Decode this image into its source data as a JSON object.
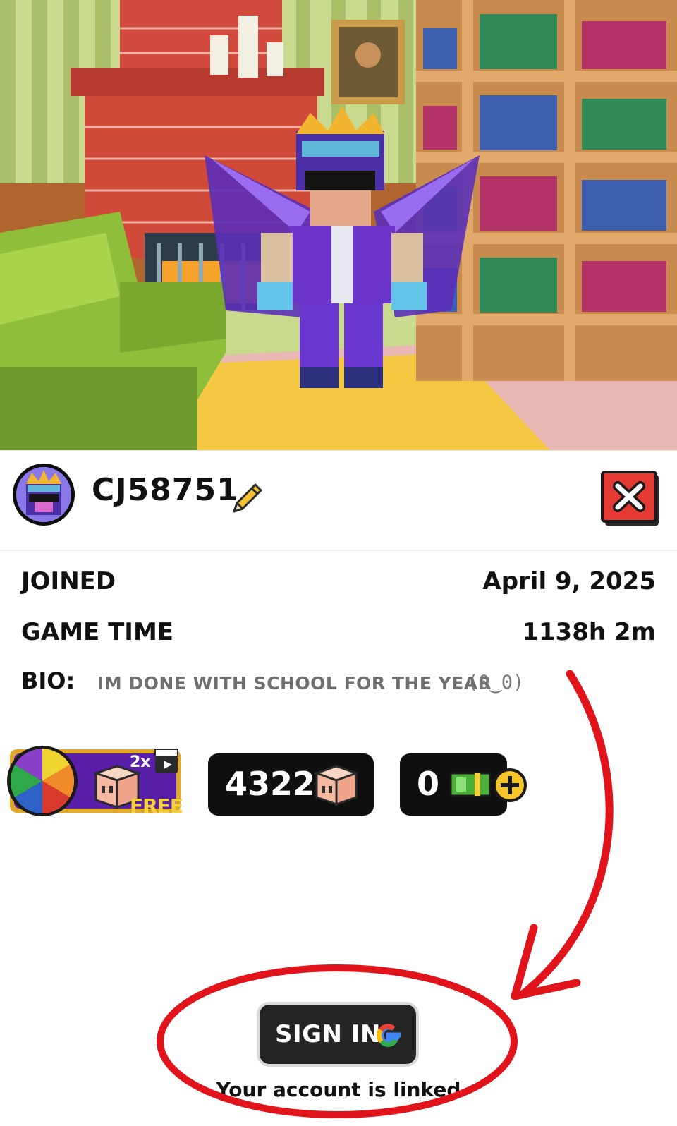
{
  "profile": {
    "username": "CJ58751",
    "joined_label": "JOINED",
    "joined_value": "April 9, 2025",
    "gametime_label": "GAME TIME",
    "gametime_value": "1138h 2m",
    "bio_label": "BIO:",
    "bio_text": "IM DONE WITH SCHOOL FOR THE YEAR",
    "bio_face": "(0‿0)"
  },
  "rewards": {
    "multiplier": "2x",
    "free_label": "FREE"
  },
  "currency": {
    "cubes": "4322",
    "cash": "0"
  },
  "account": {
    "signin_label": "SIGN IN",
    "linked_text": "Your account is linked"
  },
  "colors": {
    "annotation_red": "#e0141a",
    "close_red": "#e53a34",
    "counter_bg": "#0f0f10"
  },
  "icons": [
    "pencil-icon",
    "close-icon",
    "cube-icon",
    "cash-icon",
    "plus-icon",
    "google-icon",
    "prize-wheel-icon",
    "video-ad-icon"
  ]
}
